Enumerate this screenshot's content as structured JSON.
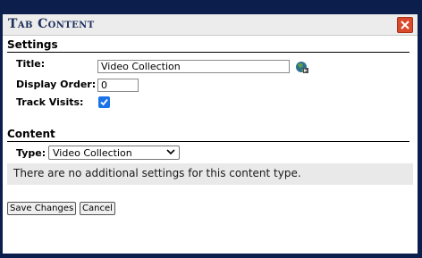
{
  "dialog": {
    "title": "Tab Content",
    "close_icon": "close-icon"
  },
  "settings": {
    "heading": "Settings",
    "title_label": "Title:",
    "title_value": "Video Collection",
    "display_order_label": "Display Order:",
    "display_order_value": "0",
    "track_visits_label": "Track Visits:",
    "track_visits_checked": true,
    "globe_icon": "globe-icon"
  },
  "content": {
    "heading": "Content",
    "type_label": "Type:",
    "type_selected": "Video Collection",
    "info_message": "There are no additional settings for this content type."
  },
  "buttons": {
    "save": "Save Changes",
    "cancel": "Cancel"
  },
  "colors": {
    "background": "#0c1e4c",
    "title_text": "#1b2f5c",
    "close_button": "#d9492c",
    "checkbox": "#1a73e8"
  }
}
